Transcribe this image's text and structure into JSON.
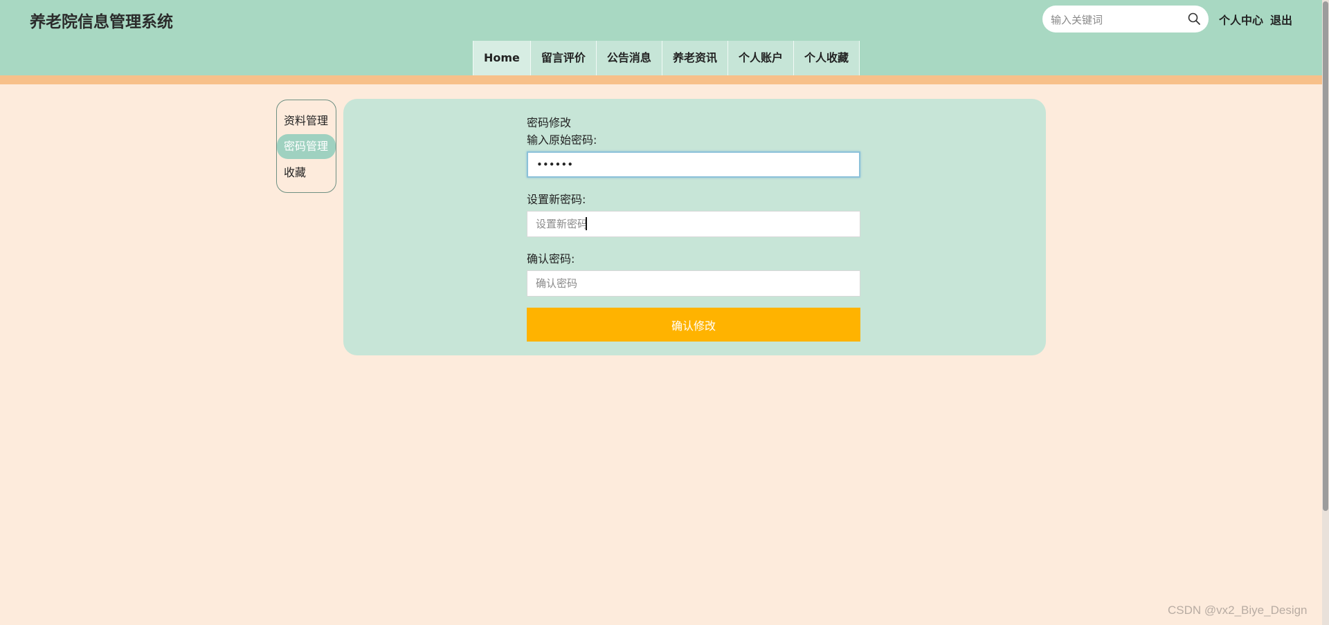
{
  "header": {
    "site_title": "养老院信息管理系统",
    "search_placeholder": "输入关键词",
    "personal_center": "个人中心",
    "logout": "退出"
  },
  "nav": {
    "items": [
      {
        "label": "Home"
      },
      {
        "label": "留言评价"
      },
      {
        "label": "公告消息"
      },
      {
        "label": "养老资讯"
      },
      {
        "label": "个人账户"
      },
      {
        "label": "个人收藏"
      }
    ]
  },
  "sidebar": {
    "items": [
      {
        "label": "资料管理"
      },
      {
        "label": "密码管理",
        "active": true
      },
      {
        "label": "收藏"
      }
    ]
  },
  "form": {
    "title": "密码修改",
    "old_password_label": "输入原始密码:",
    "old_password_value": "••••••",
    "new_password_label": "设置新密码:",
    "new_password_placeholder": "设置新密码",
    "confirm_password_label": "确认密码:",
    "confirm_password_placeholder": "确认密码",
    "submit_label": "确认修改"
  },
  "watermark": "CSDN @vx2_Biye_Design",
  "colors": {
    "header_bg": "#a8d8c2",
    "stripe": "#f7c08a",
    "page_bg": "#fdebdc",
    "panel_bg": "#c7e5d7",
    "accent_button": "#ffb300",
    "sidebar_active": "#9fd1c0"
  }
}
